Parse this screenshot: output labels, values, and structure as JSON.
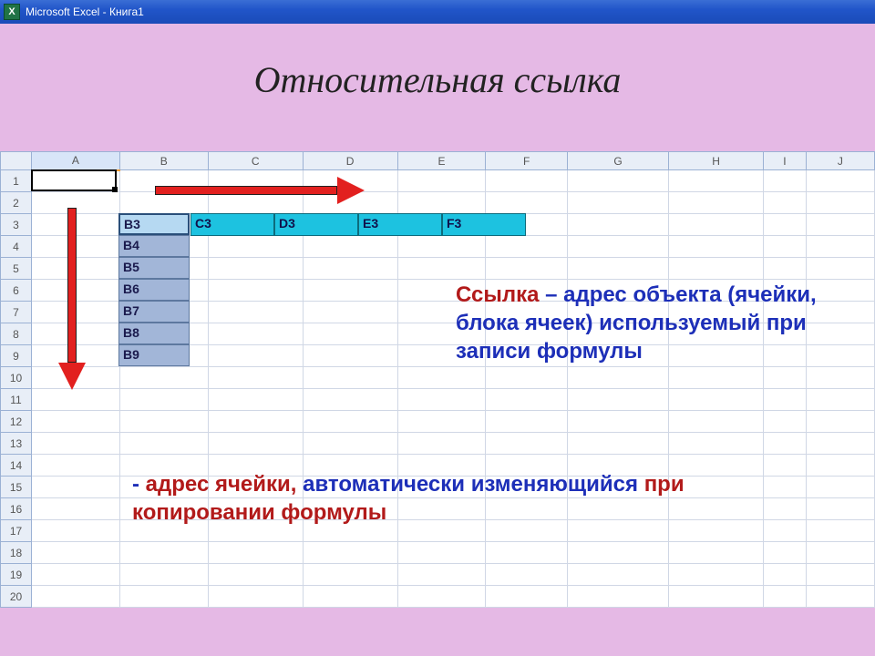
{
  "titlebar": {
    "app_icon": "X",
    "title": "Microsoft Excel - Книга1"
  },
  "slide": {
    "title": "Относительная ссылка"
  },
  "sheet": {
    "columns": [
      "A",
      "B",
      "C",
      "D",
      "E",
      "F",
      "G",
      "H",
      "I",
      "J"
    ],
    "rows": [
      "1",
      "2",
      "3",
      "4",
      "5",
      "6",
      "7",
      "8",
      "9",
      "10",
      "11",
      "12",
      "13",
      "14",
      "15",
      "16",
      "17",
      "18",
      "19",
      "20"
    ],
    "selected_column": "A"
  },
  "vlabels": [
    "B3",
    "B4",
    "B5",
    "B6",
    "B7",
    "B8",
    "B9"
  ],
  "hlabels": [
    "C3",
    "D3",
    "E3",
    "F3"
  ],
  "definition": {
    "word": "Ссылка",
    "dash": " – ",
    "rest": "адрес объекта (ячейки, блока ячеек) используемый при записи формулы"
  },
  "explanation": {
    "dash": " - ",
    "p1": "адрес ячейки, ",
    "p2": "автоматически изменяющийся ",
    "p3": "при копировании формулы"
  }
}
